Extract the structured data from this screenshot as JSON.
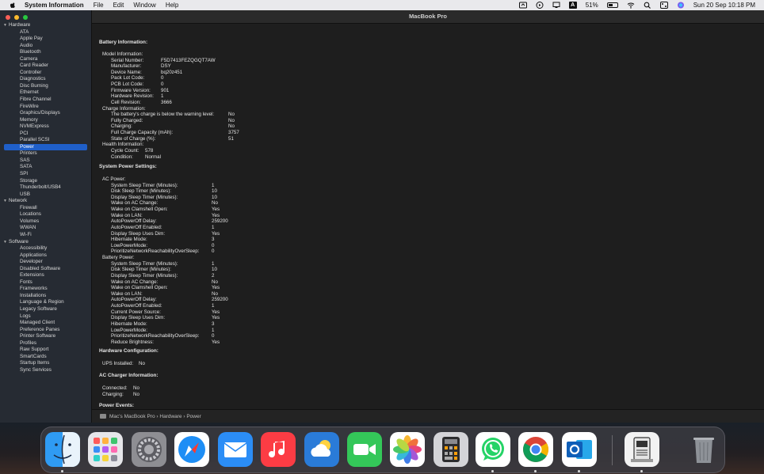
{
  "menubar": {
    "app_name": "System Information",
    "menus": [
      "File",
      "Edit",
      "Window",
      "Help"
    ],
    "battery_percent": "51%",
    "battery_level": 0.51,
    "datetime": "Sun 20 Sep  10:18 PM",
    "input_source": "A"
  },
  "window": {
    "title": "MacBook Pro"
  },
  "sidebar": {
    "groups": [
      {
        "label": "Hardware",
        "items": [
          "ATA",
          "Apple Pay",
          "Audio",
          "Bluetooth",
          "Camera",
          "Card Reader",
          "Controller",
          "Diagnostics",
          "Disc Burning",
          "Ethernet",
          "Fibre Channel",
          "FireWire",
          "Graphics/Displays",
          "Memory",
          "NVMExpress",
          "PCI",
          "Parallel SCSI",
          "Power",
          "Printers",
          "SAS",
          "SATA",
          "SPI",
          "Storage",
          "Thunderbolt/USB4",
          "USB"
        ]
      },
      {
        "label": "Network",
        "items": [
          "Firewall",
          "Locations",
          "Volumes",
          "WWAN",
          "Wi-Fi"
        ]
      },
      {
        "label": "Software",
        "items": [
          "Accessibility",
          "Applications",
          "Developer",
          "Disabled Software",
          "Extensions",
          "Fonts",
          "Frameworks",
          "Installations",
          "Language & Region",
          "Legacy Software",
          "Logs",
          "Managed Client",
          "Preference Panes",
          "Printer Software",
          "Profiles",
          "Raw Support",
          "SmartCards",
          "Startup Items",
          "Sync Services"
        ]
      }
    ],
    "selected": "Power"
  },
  "content": {
    "battery_info": {
      "heading": "Battery Information:",
      "rows": [
        {
          "k": "Model Information:",
          "v": "",
          "indent": 1
        },
        {
          "k": "Serial Number:",
          "v": "F5D7413FEZQGQT7AW",
          "indent": 2
        },
        {
          "k": "Manufacturer:",
          "v": "DSY",
          "indent": 2
        },
        {
          "k": "Device Name:",
          "v": "bq20z451",
          "indent": 2
        },
        {
          "k": "Pack Lot Code:",
          "v": "0",
          "indent": 2
        },
        {
          "k": "PCB Lot Code:",
          "v": "0",
          "indent": 2
        },
        {
          "k": "Firmware Version:",
          "v": "901",
          "indent": 2
        },
        {
          "k": "Hardware Revision:",
          "v": "1",
          "indent": 2
        },
        {
          "k": "Cell Revision:",
          "v": "3666",
          "indent": 2
        },
        {
          "k": "Charge Information:",
          "v": "",
          "indent": 1
        },
        {
          "k": "The battery's charge is below the warning level:",
          "v": "No",
          "indent": 2,
          "col": "far"
        },
        {
          "k": "Fully Charged:",
          "v": "No",
          "indent": 2,
          "col": "far"
        },
        {
          "k": "Charging:",
          "v": "No",
          "indent": 2,
          "col": "far"
        },
        {
          "k": "Full Charge Capacity (mAh):",
          "v": "3757",
          "indent": 2,
          "col": "far"
        },
        {
          "k": "State of Charge (%):",
          "v": "51",
          "indent": 2,
          "col": "far"
        },
        {
          "k": "Health Information:",
          "v": "",
          "indent": 1
        },
        {
          "k": "Cycle Count:",
          "v": "578",
          "indent": 2,
          "col": "short"
        },
        {
          "k": "Condition:",
          "v": "Normal",
          "indent": 2,
          "col": "short"
        }
      ]
    },
    "power_settings": {
      "heading": "System Power Settings:",
      "ac_label": "AC Power:",
      "ac_rows": [
        {
          "k": "System Sleep Timer (Minutes):",
          "v": "1"
        },
        {
          "k": "Disk Sleep Timer (Minutes):",
          "v": "10"
        },
        {
          "k": "Display Sleep Timer (Minutes):",
          "v": "10"
        },
        {
          "k": "Wake on AC Change:",
          "v": "No"
        },
        {
          "k": "Wake on Clamshell Open:",
          "v": "Yes"
        },
        {
          "k": "Wake on LAN:",
          "v": "Yes"
        },
        {
          "k": "AutoPowerOff Delay:",
          "v": "259200"
        },
        {
          "k": "AutoPowerOff Enabled:",
          "v": "1"
        },
        {
          "k": "Display Sleep Uses Dim:",
          "v": "Yes"
        },
        {
          "k": "Hibernate Mode:",
          "v": "3"
        },
        {
          "k": "LowPowerMode:",
          "v": "0"
        },
        {
          "k": "PrioritizeNetworkReachabilityOverSleep:",
          "v": "0"
        }
      ],
      "battery_label": "Battery Power:",
      "battery_rows": [
        {
          "k": "System Sleep Timer (Minutes):",
          "v": "1"
        },
        {
          "k": "Disk Sleep Timer (Minutes):",
          "v": "10"
        },
        {
          "k": "Display Sleep Timer (Minutes):",
          "v": "2"
        },
        {
          "k": "Wake on AC Change:",
          "v": "No"
        },
        {
          "k": "Wake on Clamshell Open:",
          "v": "Yes"
        },
        {
          "k": "Wake on LAN:",
          "v": "No"
        },
        {
          "k": "AutoPowerOff Delay:",
          "v": "259200"
        },
        {
          "k": "AutoPowerOff Enabled:",
          "v": "1"
        },
        {
          "k": "Current Power Source:",
          "v": "Yes"
        },
        {
          "k": "Display Sleep Uses Dim:",
          "v": "Yes"
        },
        {
          "k": "Hibernate Mode:",
          "v": "3"
        },
        {
          "k": "LowPowerMode:",
          "v": "1"
        },
        {
          "k": "PrioritizeNetworkReachabilityOverSleep:",
          "v": "0"
        },
        {
          "k": "Reduce Brightness:",
          "v": "Yes"
        }
      ]
    },
    "hardware_config": {
      "heading": "Hardware Configuration:",
      "rows": [
        {
          "k": "UPS Installed:",
          "v": "No"
        }
      ]
    },
    "ac_charger": {
      "heading": "AC Charger Information:",
      "rows": [
        {
          "k": "Connected:",
          "v": "No"
        },
        {
          "k": "Charging:",
          "v": "No"
        }
      ]
    },
    "power_events": {
      "heading": "Power Events:"
    }
  },
  "pathbar": {
    "path": "Mac's MacBook Pro › Hardware › Power"
  },
  "dock": {
    "apps": [
      {
        "name": "finder-icon",
        "running": true
      },
      {
        "name": "launchpad-icon",
        "running": false
      },
      {
        "name": "system-preferences-icon",
        "running": false
      },
      {
        "name": "safari-icon",
        "running": false
      },
      {
        "name": "mail-icon",
        "running": false
      },
      {
        "name": "music-icon",
        "running": false
      },
      {
        "name": "weather-icon",
        "running": false
      },
      {
        "name": "facetime-icon",
        "running": false
      },
      {
        "name": "photos-icon",
        "running": false
      },
      {
        "name": "calculator-icon",
        "running": false
      },
      {
        "name": "whatsapp-icon",
        "running": true
      },
      {
        "name": "chrome-icon",
        "running": true
      },
      {
        "name": "outlook-icon",
        "running": true
      },
      {
        "name": "system-information-icon",
        "running": true
      },
      {
        "name": "trash-icon",
        "running": false
      }
    ]
  }
}
